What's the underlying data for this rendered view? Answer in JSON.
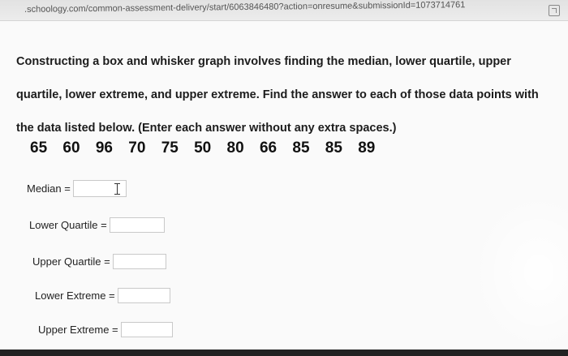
{
  "browser": {
    "url": ".schoology.com/common-assessment-delivery/start/6063846480?action=onresume&submissionId=1073714761"
  },
  "question": {
    "line1": "Constructing a box and whisker graph involves finding the median, lower quartile, upper",
    "line2": "quartile, lower extreme, and upper extreme.  Find the answer to each of those data points with",
    "line3": "the data listed below.  (Enter each answer without any extra spaces.)"
  },
  "data_values": [
    "65",
    "60",
    "96",
    "70",
    "75",
    "50",
    "80",
    "66",
    "85",
    "85",
    "89"
  ],
  "fields": {
    "median": {
      "label": "Median =",
      "value": ""
    },
    "lower_quartile": {
      "label": "Lower Quartile =",
      "value": ""
    },
    "upper_quartile": {
      "label": "Upper Quartile =",
      "value": ""
    },
    "lower_extreme": {
      "label": "Lower Extreme =",
      "value": ""
    },
    "upper_extreme": {
      "label": "Upper Extreme =",
      "value": ""
    }
  },
  "icons": {
    "extension": "external-link-icon",
    "cursor": "text-cursor-icon"
  }
}
